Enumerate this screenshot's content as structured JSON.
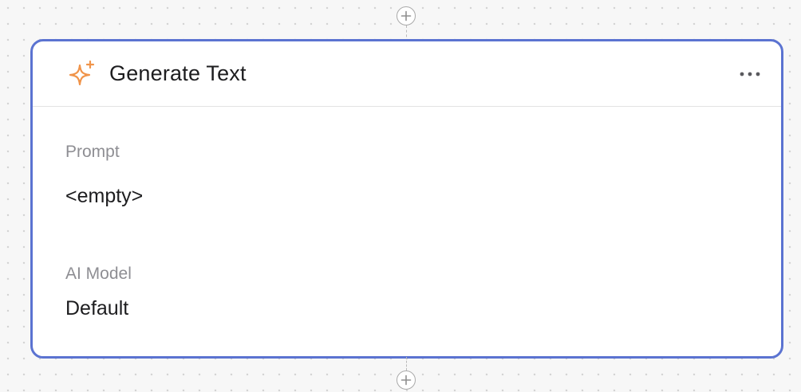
{
  "node": {
    "title": "Generate Text",
    "icon": "sparkle-icon",
    "accent_color": "#5b73d1",
    "icon_color": "#f0944a",
    "menu_icon": "more-horizontal-icon"
  },
  "fields": {
    "prompt_label": "Prompt",
    "prompt_value": "<empty>",
    "model_label": "AI Model",
    "model_value": "Default"
  },
  "connectors": {
    "add_icon": "plus-circle-icon"
  }
}
